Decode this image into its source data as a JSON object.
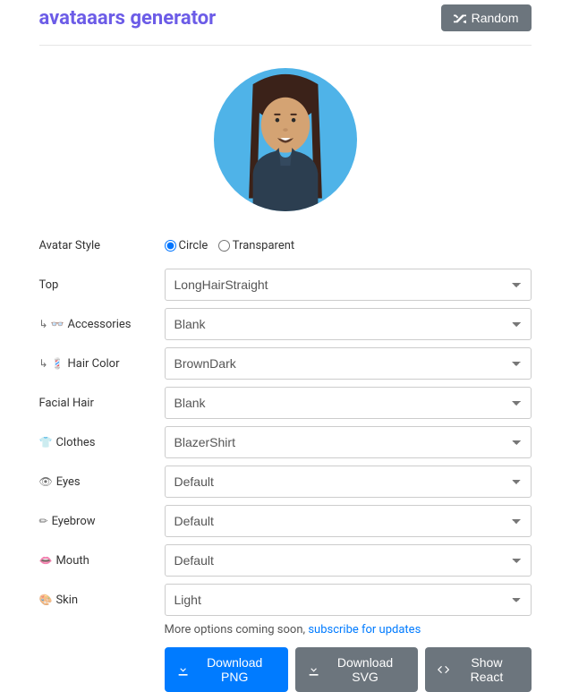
{
  "header": {
    "title": "avataaars generator",
    "random_label": "Random"
  },
  "fields": {
    "avatar_style": {
      "label": "Avatar Style",
      "radio1": "Circle",
      "radio2": "Transparent"
    },
    "top": {
      "label": "Top",
      "value": "LongHairStraight"
    },
    "accessories": {
      "prefix": "↳ 👓",
      "label": "Accessories",
      "value": "Blank"
    },
    "hair_color": {
      "prefix": "↳ 💈",
      "label": "Hair Color",
      "value": "BrownDark"
    },
    "facial_hair": {
      "label": "Facial Hair",
      "value": "Blank"
    },
    "clothes": {
      "prefix": "👕",
      "label": "Clothes",
      "value": "BlazerShirt"
    },
    "eyes": {
      "prefix": "👁",
      "label": "Eyes",
      "value": "Default"
    },
    "eyebrow": {
      "prefix": "✏",
      "label": "Eyebrow",
      "value": "Default"
    },
    "mouth": {
      "prefix": "👄",
      "label": "Mouth",
      "value": "Default"
    },
    "skin": {
      "prefix": "🎨",
      "label": "Skin",
      "value": "Light"
    }
  },
  "helper": {
    "text": "More options coming soon, ",
    "link": "subscribe for updates"
  },
  "buttons": {
    "download_png": "Download PNG",
    "download_svg": "Download SVG",
    "show_react": "Show React"
  }
}
